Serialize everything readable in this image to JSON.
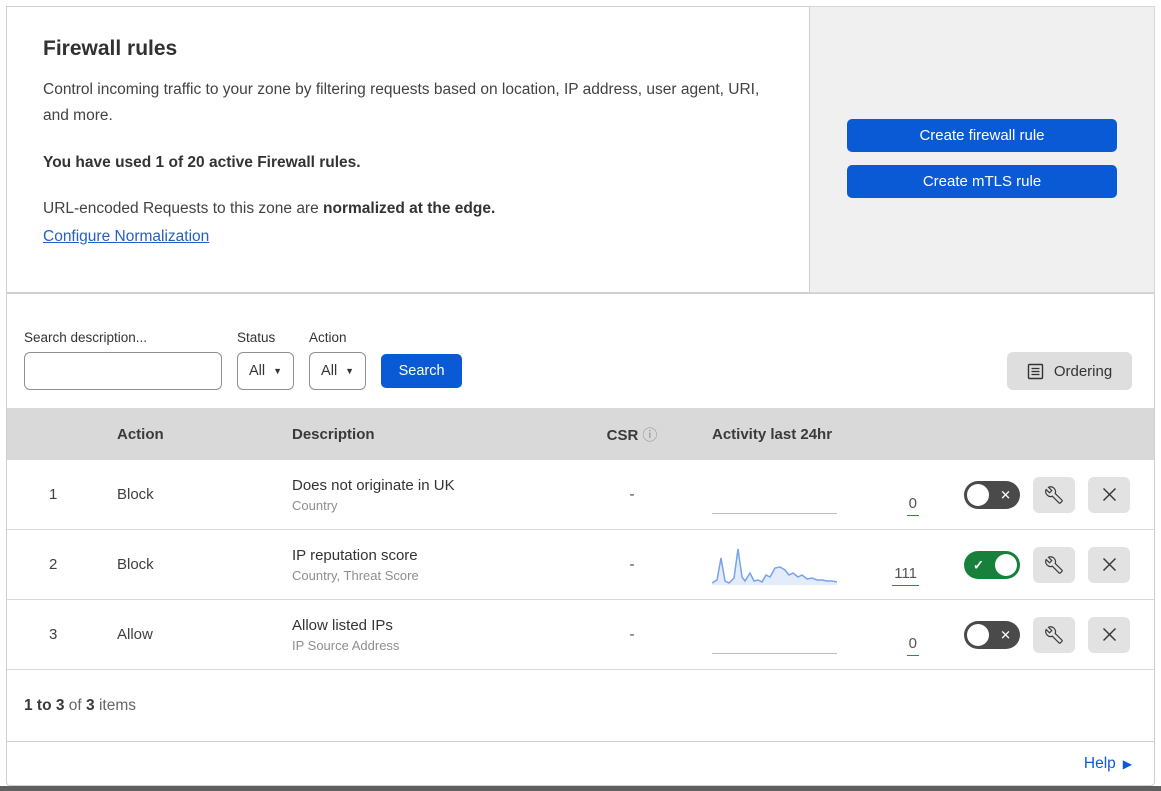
{
  "header": {
    "title": "Firewall rules",
    "description": "Control incoming traffic to your zone by filtering requests based on location, IP address, user agent, URI, and more.",
    "usage_text": "You have used 1 of 20 active Firewall rules.",
    "normalization_prefix": "URL-encoded Requests to this zone are ",
    "normalization_bold": "normalized at the edge.",
    "normalization_link": "Configure Normalization",
    "create_firewall_button": "Create firewall rule",
    "create_mtls_button": "Create mTLS rule"
  },
  "filters": {
    "search_label": "Search description...",
    "search_value": "",
    "status_label": "Status",
    "status_value": "All",
    "action_label": "Action",
    "action_value": "All",
    "search_button": "Search",
    "ordering_button": "Ordering"
  },
  "table": {
    "columns": {
      "action": "Action",
      "description": "Description",
      "csr": "CSR",
      "csr_info_icon": "ⓘ",
      "activity": "Activity last 24hr"
    },
    "rows": [
      {
        "index": "1",
        "action": "Block",
        "description": "Does not originate in UK",
        "fields": "Country",
        "csr": "-",
        "activity_count": "0",
        "enabled": false
      },
      {
        "index": "2",
        "action": "Block",
        "description": "IP reputation score",
        "fields": "Country, Threat Score",
        "csr": "-",
        "activity_count": "111",
        "enabled": true,
        "sparkline_points": [
          [
            0,
            39
          ],
          [
            5,
            36
          ],
          [
            9,
            14
          ],
          [
            13,
            37
          ],
          [
            17,
            39
          ],
          [
            22,
            34
          ],
          [
            26,
            5
          ],
          [
            30,
            33
          ],
          [
            33,
            37
          ],
          [
            38,
            29
          ],
          [
            42,
            37
          ],
          [
            46,
            36
          ],
          [
            50,
            38
          ],
          [
            54,
            31
          ],
          [
            58,
            33
          ],
          [
            63,
            24
          ],
          [
            68,
            23
          ],
          [
            73,
            26
          ],
          [
            77,
            31
          ],
          [
            81,
            29
          ],
          [
            86,
            33
          ],
          [
            90,
            31
          ],
          [
            95,
            35
          ],
          [
            100,
            34
          ],
          [
            105,
            36
          ],
          [
            110,
            36
          ],
          [
            115,
            37
          ],
          [
            120,
            37
          ],
          [
            125,
            38
          ]
        ]
      },
      {
        "index": "3",
        "action": "Allow",
        "description": "Allow listed IPs",
        "fields": "IP Source Address",
        "csr": "-",
        "activity_count": "0",
        "enabled": false
      }
    ]
  },
  "footer": {
    "range": "1 to 3",
    "of_word": "of",
    "total": "3",
    "items_word": "items",
    "help_link": "Help"
  },
  "toggle": {
    "check_glyph": "✓",
    "x_glyph": "✕"
  },
  "colors": {
    "accent_blue": "#0b5ad5",
    "link_blue": "#2460c2",
    "toggle_on_green": "#17813c",
    "toggle_off_gray": "#4a4a4a",
    "sparkline_line": "#76a3ea",
    "sparkline_fill": "#e3ecfa",
    "table_header_gray": "#d9d9d9",
    "panel_gray": "#f0f0f0"
  }
}
